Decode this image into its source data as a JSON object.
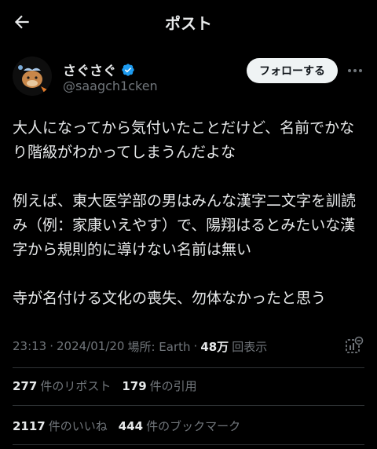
{
  "header": {
    "title": "ポスト",
    "back_icon": "arrow-left-icon"
  },
  "author": {
    "display_name": "さぐさぐ",
    "handle": "@saagch1cken",
    "verified_icon": "verified-badge-icon",
    "verified_color": "#1d9bf0",
    "follow_label": "フォローする",
    "more_icon": "more-dots-icon"
  },
  "post": {
    "paragraphs": [
      "大人になってから気付いたことだけど、名前でかなり階級がわかってしまうんだよな",
      "例えば、東大医学部の男はみんな漢字二文字を訓読み（例：家康いえやす）で、陽翔はるとみたいな漢字から規則的に導けない名前は無い",
      "寺が名付ける文化の喪失、勿体なかったと思う"
    ],
    "time": "23:13",
    "date": "2024/01/20",
    "separator": "·",
    "location_label": "場所: Earth",
    "views_count": "48万",
    "views_label": "回表示",
    "analytics_icon": "analytics-icon"
  },
  "stats": {
    "reposts_count": "277",
    "reposts_label": "件のリポスト",
    "quotes_count": "179",
    "quotes_label": "件の引用",
    "likes_count": "2117",
    "likes_label": "件のいいね",
    "bookmarks_count": "444",
    "bookmarks_label": "件のブックマーク"
  },
  "colors": {
    "background": "#000000",
    "text": "#e7e9ea",
    "secondary": "#71767b",
    "divider": "#2f3336",
    "accent": "#1d9bf0"
  }
}
